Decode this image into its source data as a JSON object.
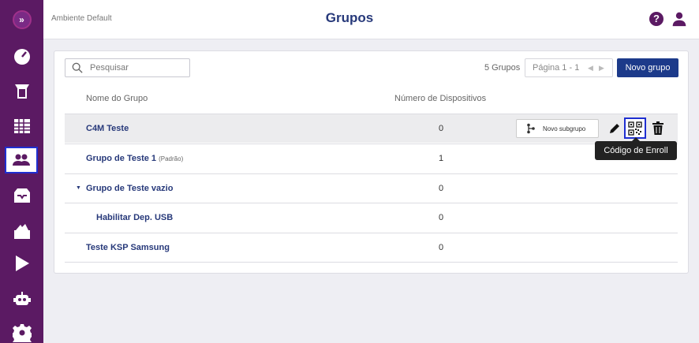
{
  "header": {
    "environment": "Ambiente Default",
    "title": "Grupos"
  },
  "sidebar": {
    "items": [
      {
        "icon": "dashboard-icon"
      },
      {
        "icon": "device-icon"
      },
      {
        "icon": "table-icon"
      },
      {
        "icon": "groups-icon",
        "active": true
      },
      {
        "icon": "inbox-icon"
      },
      {
        "icon": "apps-icon"
      },
      {
        "icon": "play-store-icon"
      },
      {
        "icon": "robot-icon"
      },
      {
        "icon": "settings-icon"
      }
    ]
  },
  "toolbar": {
    "search_placeholder": "Pesquisar",
    "count": "5 Grupos",
    "pagination": "Página 1 - 1",
    "new_group": "Novo grupo"
  },
  "table": {
    "headers": [
      "Nome do Grupo",
      "Número de Dispositivos"
    ],
    "rows": [
      {
        "name": "C4M Teste",
        "devices": "0"
      },
      {
        "name": "Grupo de Teste 1",
        "tag": "(Padrão)",
        "devices": "1"
      },
      {
        "name": "Grupo de Teste vazio",
        "devices": "0"
      },
      {
        "name": "Habilitar Dep. USB",
        "devices": "0"
      },
      {
        "name": "Teste KSP Samsung",
        "devices": "0"
      }
    ]
  },
  "row_actions": {
    "new_subgroup": "Novo subgrupo"
  },
  "tooltip": "Código de Enroll",
  "colors": {
    "sidebar": "#5b1a63",
    "title": "#27397a",
    "primary_button": "#1c3a8a",
    "highlight_border": "#1f2fd1"
  }
}
